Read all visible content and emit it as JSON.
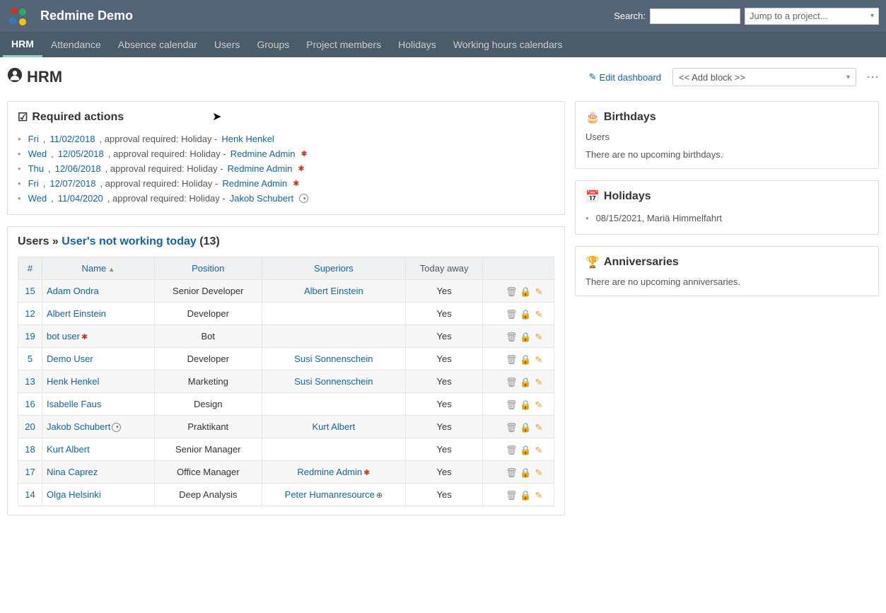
{
  "header": {
    "app_title": "Redmine Demo",
    "search_label": "Search:",
    "project_select": "Jump to a project..."
  },
  "nav": {
    "items": [
      {
        "label": "HRM",
        "active": true
      },
      {
        "label": "Attendance"
      },
      {
        "label": "Absence calendar"
      },
      {
        "label": "Users"
      },
      {
        "label": "Groups"
      },
      {
        "label": "Project members"
      },
      {
        "label": "Holidays"
      },
      {
        "label": "Working hours calendars"
      }
    ]
  },
  "page": {
    "title": "HRM",
    "edit_dashboard": "Edit dashboard",
    "add_block": "<< Add block >>"
  },
  "required_actions": {
    "title": "Required actions",
    "items": [
      {
        "day": "Fri",
        "date": "11/02/2018",
        "text": ", approval required: Holiday - ",
        "user": "Henk Henkel",
        "badge": ""
      },
      {
        "day": "Wed",
        "date": "12/05/2018",
        "text": ", approval required: Holiday - ",
        "user": "Redmine Admin",
        "badge": "gear"
      },
      {
        "day": "Thu",
        "date": "12/06/2018",
        "text": ", approval required: Holiday - ",
        "user": "Redmine Admin",
        "badge": "gear"
      },
      {
        "day": "Fri",
        "date": "12/07/2018",
        "text": ", approval required: Holiday - ",
        "user": "Redmine Admin",
        "badge": "gear"
      },
      {
        "day": "Wed",
        "date": "11/04/2020",
        "text": ", approval required: Holiday - ",
        "user": "Jakob Schubert",
        "badge": "clock"
      }
    ]
  },
  "users_block": {
    "prefix": "Users » ",
    "link": "User's not working today",
    "count": "(13)",
    "columns": {
      "id": "#",
      "name": "Name",
      "position": "Position",
      "superiors": "Superiors",
      "today_away": "Today away"
    },
    "rows": [
      {
        "id": "15",
        "name": "Adam Ondra",
        "position": "Senior Developer",
        "superior": "Albert Einstein",
        "away": "Yes",
        "name_badge": "",
        "sup_badge": ""
      },
      {
        "id": "12",
        "name": "Albert Einstein",
        "position": "Developer",
        "superior": "",
        "away": "Yes",
        "name_badge": "",
        "sup_badge": ""
      },
      {
        "id": "19",
        "name": "bot user",
        "position": "Bot",
        "superior": "",
        "away": "Yes",
        "name_badge": "gear",
        "sup_badge": ""
      },
      {
        "id": "5",
        "name": "Demo User",
        "position": "Developer",
        "superior": "Susi Sonnenschein",
        "away": "Yes",
        "name_badge": "",
        "sup_badge": ""
      },
      {
        "id": "13",
        "name": "Henk Henkel",
        "position": "Marketing",
        "superior": "Susi Sonnenschein",
        "away": "Yes",
        "name_badge": "",
        "sup_badge": ""
      },
      {
        "id": "16",
        "name": "Isabelle Faus",
        "position": "Design",
        "superior": "",
        "away": "Yes",
        "name_badge": "",
        "sup_badge": ""
      },
      {
        "id": "20",
        "name": "Jakob Schubert",
        "position": "Praktikant",
        "superior": "Kurt Albert",
        "away": "Yes",
        "name_badge": "clock",
        "sup_badge": ""
      },
      {
        "id": "18",
        "name": "Kurt Albert",
        "position": "Senior Manager",
        "superior": "",
        "away": "Yes",
        "name_badge": "",
        "sup_badge": ""
      },
      {
        "id": "17",
        "name": "Nina Caprez",
        "position": "Office Manager",
        "superior": "Redmine Admin",
        "away": "Yes",
        "name_badge": "",
        "sup_badge": "gear"
      },
      {
        "id": "14",
        "name": "Olga Helsinki",
        "position": "Deep Analysis",
        "superior": "Peter Humanresource",
        "away": "Yes",
        "name_badge": "",
        "sup_badge": "hr"
      }
    ]
  },
  "birthdays": {
    "title": "Birthdays",
    "sub": "Users",
    "empty": "There are no upcoming birthdays."
  },
  "holidays": {
    "title": "Holidays",
    "items": [
      {
        "text": "08/15/2021, Mariä Himmelfahrt"
      }
    ]
  },
  "anniversaries": {
    "title": "Anniversaries",
    "empty": "There are no upcoming anniversaries."
  }
}
